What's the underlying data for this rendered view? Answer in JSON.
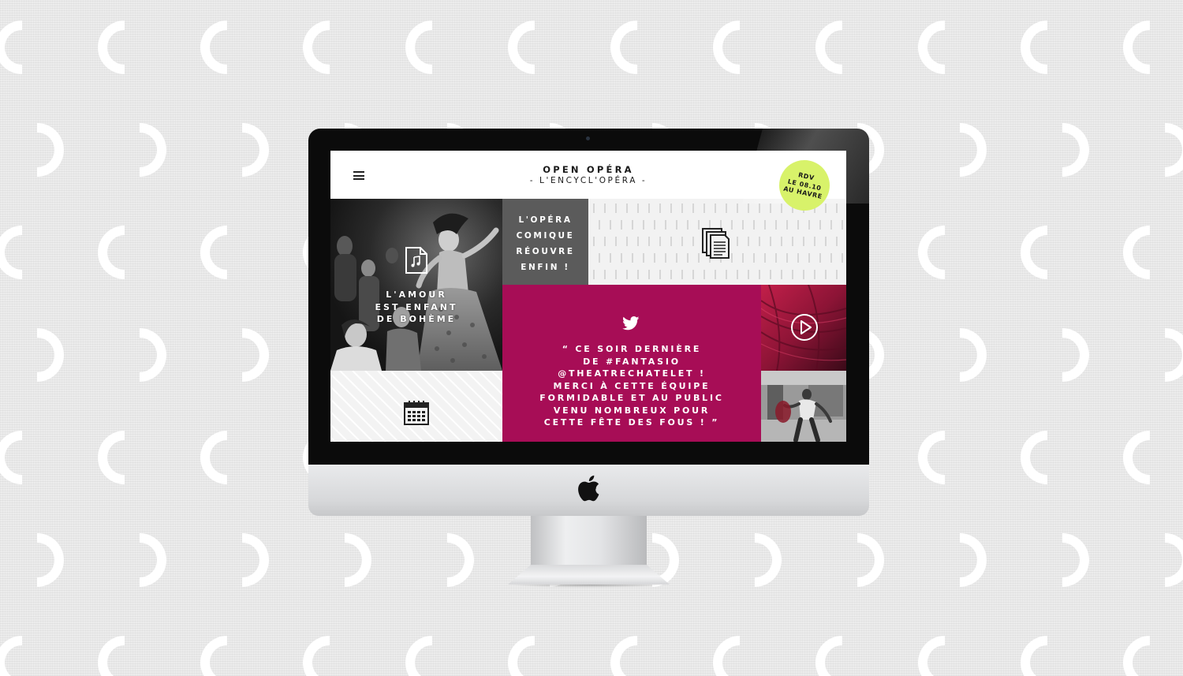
{
  "site": {
    "title": "OPEN OPÉRA",
    "subtitle": "- L'ENCYCL'OPÉRA -"
  },
  "menu": {
    "icon": "hamburger-icon"
  },
  "badge": {
    "lines": [
      "RDV",
      "LE 08.10",
      "AU HAVRE"
    ],
    "color": "#d8f26a"
  },
  "tiles": {
    "amour": {
      "icon": "music-file-icon",
      "title_lines": [
        "L'AMOUR",
        "EST  ENFANT",
        "DE BOHÈME"
      ]
    },
    "opera_comique": {
      "title_lines": [
        "L'OPÉRA",
        "COMIQUE",
        "RÉOUVRE",
        "ENFIN !"
      ]
    },
    "documents": {
      "icon": "documents-icon"
    },
    "tweet": {
      "icon": "twitter-icon",
      "lines": [
        "“ CE SOIR DERNIÈRE",
        "DE #FANTASIO",
        "@THEATRECHATELET !",
        "MERCI À CETTE ÉQUIPE",
        "FORMIDABLE ET AU PUBLIC",
        "VENU NOMBREUX POUR",
        "CETTE FÊTE DES FOUS ! ”"
      ],
      "color": "#a70d56"
    },
    "video": {
      "icon": "play-icon"
    },
    "calendar": {
      "icon": "calendar-icon"
    },
    "dancer": {
      "icon": ""
    }
  },
  "device": {
    "logo": "apple-logo"
  }
}
